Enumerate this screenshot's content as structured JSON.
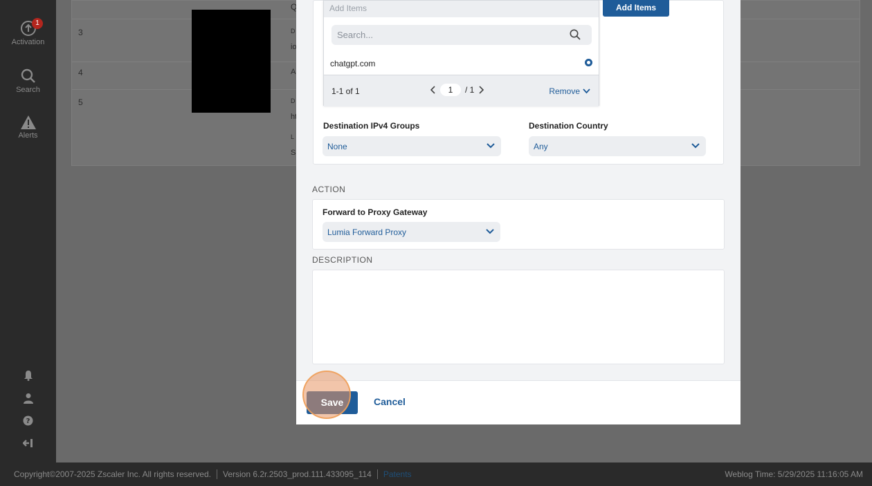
{
  "sidebar": {
    "items": [
      {
        "label": "Activation",
        "badge": "1",
        "icon": "activation-icon"
      },
      {
        "label": "Search",
        "icon": "search-icon"
      },
      {
        "label": "Alerts",
        "icon": "alert-icon"
      }
    ],
    "bottom_icons": [
      "bell-icon",
      "user-icon",
      "help-icon",
      "logout-icon"
    ]
  },
  "background_table": {
    "rows": [
      {
        "num": "3",
        "frag": "D"
      },
      {
        "num": "4",
        "frag": "A"
      },
      {
        "num": "5",
        "frag": "D"
      }
    ],
    "fragments": [
      "Q",
      "io",
      "ht",
      "L",
      "S"
    ]
  },
  "modal": {
    "add_items_placeholder": "Add Items",
    "add_items_button": "Add Items",
    "search_placeholder": "Search...",
    "selected_items": [
      "chatgpt.com"
    ],
    "pagination": {
      "count": "1-1 of 1",
      "page": "1",
      "total": "/ 1"
    },
    "remove_label": "Remove",
    "dest_ipv4_groups": {
      "label": "Destination IPv4 Groups",
      "value": "None"
    },
    "dest_country": {
      "label": "Destination Country",
      "value": "Any"
    },
    "action": {
      "section": "ACTION",
      "label": "Forward to Proxy Gateway",
      "value": "Lumia Forward Proxy"
    },
    "description": {
      "section": "DESCRIPTION",
      "value": ""
    },
    "save_label": "Save",
    "cancel_label": "Cancel"
  },
  "statusbar": {
    "copyright": "Copyright©2007-2025 Zscaler Inc. All rights reserved.",
    "version": "Version 6.2r.2503_prod.111.433095_114",
    "patents": "Patents",
    "weblog_time": "Weblog Time: 5/29/2025 11:16:05 AM"
  },
  "colors": {
    "accent": "#1f5c99",
    "sidebar": "#2a2a2a",
    "highlight": "#e89664"
  }
}
